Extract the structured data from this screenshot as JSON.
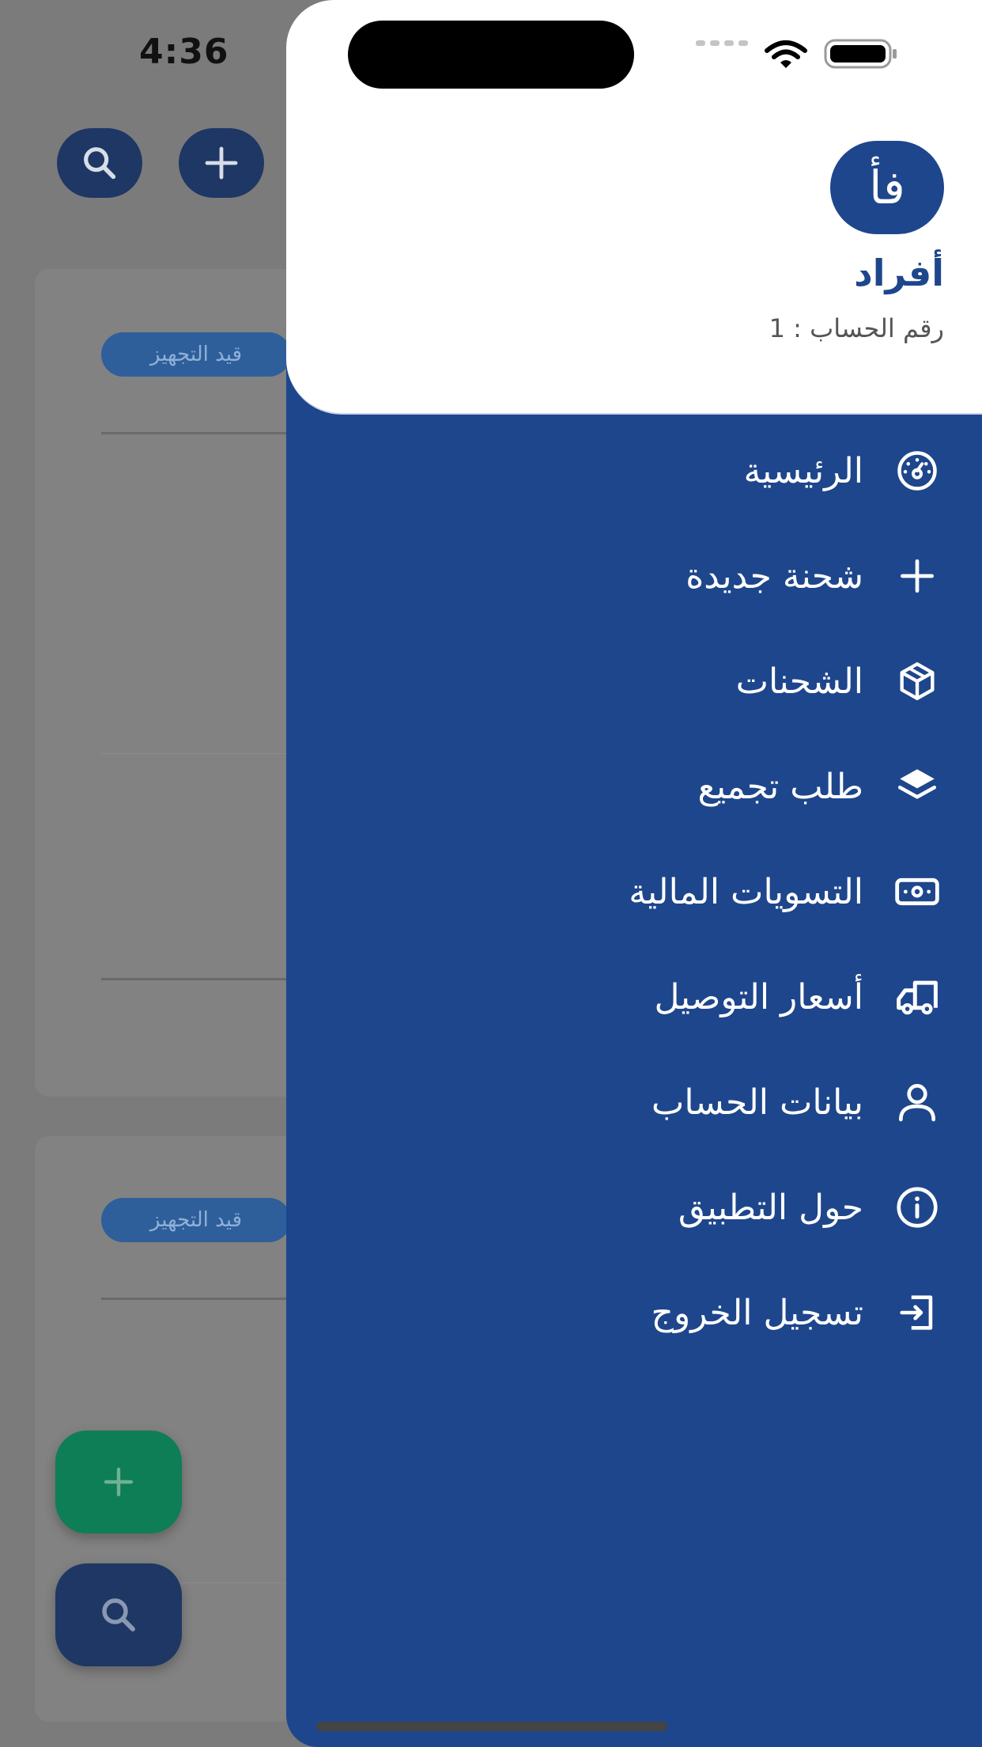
{
  "status_bar": {
    "time": "4:36"
  },
  "background": {
    "cards": [
      {
        "badge": "قيد التجهيز"
      },
      {
        "badge": "قيد التجهيز"
      }
    ],
    "colors": {
      "fab_add": "#0d7e55",
      "fab_search": "#1e3764",
      "badge": "#2e5f9a"
    }
  },
  "drawer": {
    "avatar_initials": "فأ",
    "user_name": "أفراد",
    "account_number": "رقم الحساب : 1",
    "menu": [
      {
        "label": "الرئيسية",
        "icon": "dashboard-icon"
      },
      {
        "label": "شحنة جديدة",
        "icon": "plus-icon"
      },
      {
        "label": "الشحنات",
        "icon": "box-icon"
      },
      {
        "label": "طلب تجميع",
        "icon": "layers-icon"
      },
      {
        "label": "التسويات المالية",
        "icon": "money-icon"
      },
      {
        "label": "أسعار التوصيل",
        "icon": "truck-icon"
      },
      {
        "label": "بيانات الحساب",
        "icon": "user-icon"
      },
      {
        "label": "حول التطبيق",
        "icon": "info-icon"
      },
      {
        "label": "تسجيل الخروج",
        "icon": "logout-icon"
      }
    ],
    "colors": {
      "primary": "#1e468c",
      "header_bg": "#ffffff"
    }
  }
}
